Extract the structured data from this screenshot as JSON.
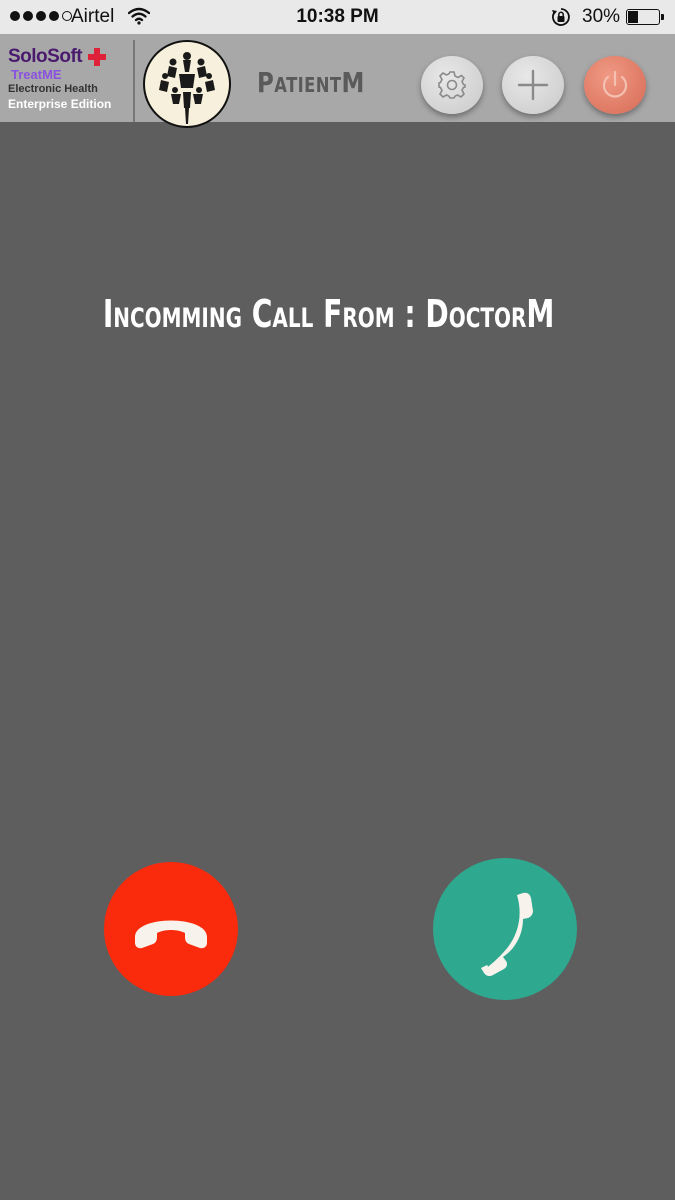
{
  "status_bar": {
    "carrier": "Airtel",
    "time": "10:38 PM",
    "battery_percent": "30%",
    "battery_level": 0.3
  },
  "header": {
    "brand_name": "SoloSoft",
    "brand_product": "TreatME",
    "brand_tagline": "Electronic Health",
    "brand_edition": "Enterprise Edition",
    "user_name": "PatientM",
    "icons": [
      "gear-icon",
      "plus-icon",
      "power-icon"
    ]
  },
  "call": {
    "message": "Incomming Call From : DoctorM",
    "decline_icon": "phone-hangup-icon",
    "accept_icon": "phone-answer-icon"
  },
  "colors": {
    "background": "#5e5e5e",
    "header": "#a8a8a8",
    "decline": "#fa2b0c",
    "accept": "#2ea88f",
    "power": "#d66a55",
    "brand": "#4a1a6e",
    "brand_accent": "#8a52e0",
    "cross": "#e0213a"
  }
}
